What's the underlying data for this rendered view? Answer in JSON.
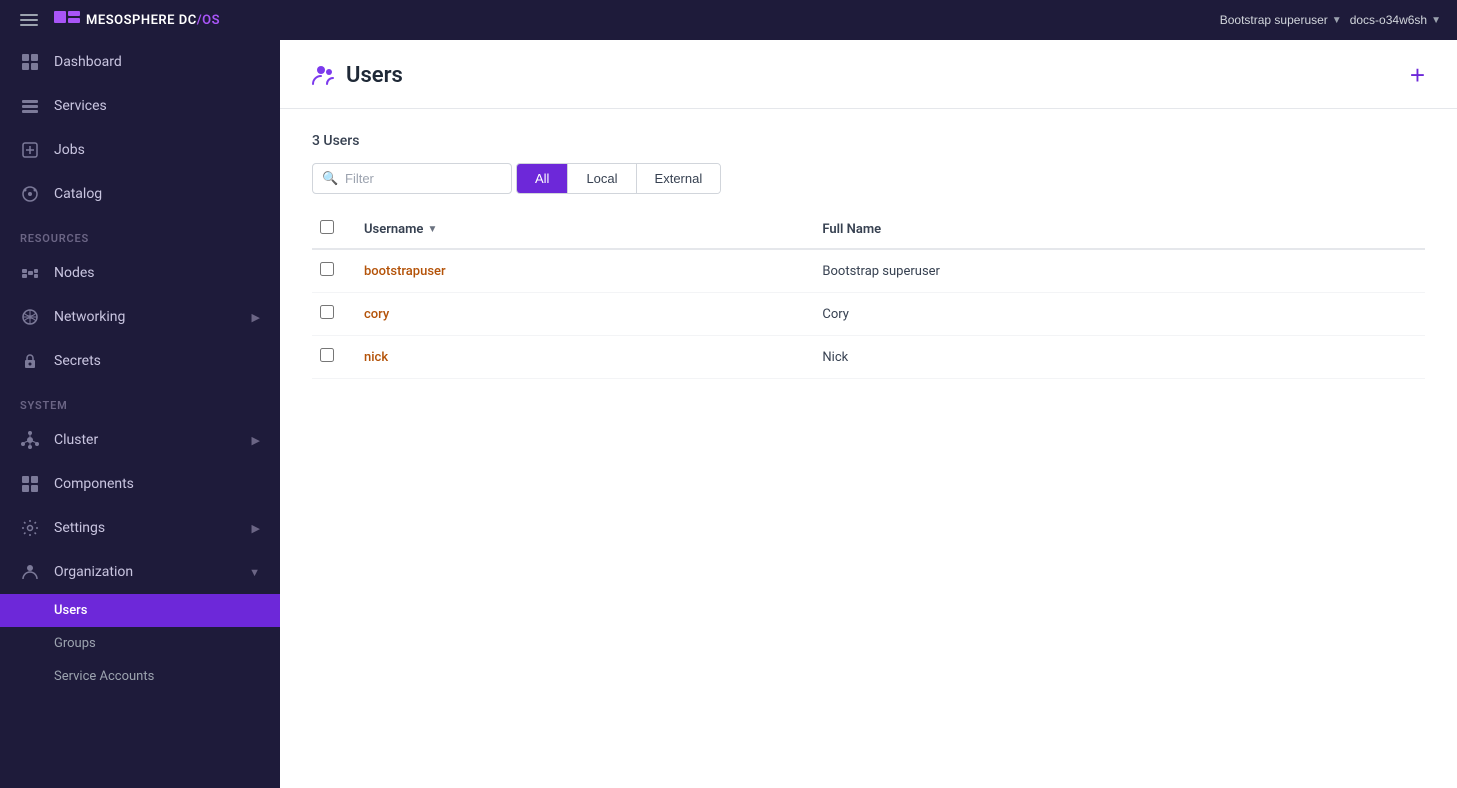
{
  "topbar": {
    "hamburger_label": "Menu",
    "logo_brand": "MESOSPHERE",
    "logo_dc": "DC",
    "logo_os": "OS",
    "user_label": "Bootstrap superuser",
    "cluster_label": "docs-o34w6sh"
  },
  "sidebar": {
    "nav_items": [
      {
        "id": "dashboard",
        "label": "Dashboard",
        "icon": "dashboard"
      },
      {
        "id": "services",
        "label": "Services",
        "icon": "services"
      },
      {
        "id": "jobs",
        "label": "Jobs",
        "icon": "jobs"
      },
      {
        "id": "catalog",
        "label": "Catalog",
        "icon": "catalog"
      }
    ],
    "resources_label": "Resources",
    "resource_items": [
      {
        "id": "nodes",
        "label": "Nodes",
        "icon": "nodes",
        "hasArrow": false
      },
      {
        "id": "networking",
        "label": "Networking",
        "icon": "networking",
        "hasArrow": true
      },
      {
        "id": "secrets",
        "label": "Secrets",
        "icon": "secrets",
        "hasArrow": false
      }
    ],
    "system_label": "System",
    "system_items": [
      {
        "id": "cluster",
        "label": "Cluster",
        "icon": "cluster",
        "hasArrow": true
      },
      {
        "id": "components",
        "label": "Components",
        "icon": "components",
        "hasArrow": false
      },
      {
        "id": "settings",
        "label": "Settings",
        "icon": "settings",
        "hasArrow": true
      },
      {
        "id": "organization",
        "label": "Organization",
        "icon": "organization",
        "hasArrow": true,
        "expanded": true
      }
    ],
    "org_subnav": [
      {
        "id": "users",
        "label": "Users",
        "active": true
      },
      {
        "id": "groups",
        "label": "Groups"
      },
      {
        "id": "service-accounts",
        "label": "Service Accounts"
      }
    ]
  },
  "page": {
    "title": "Users",
    "users_count": "3 Users",
    "filter_placeholder": "Filter",
    "add_button_label": "+",
    "tabs": [
      {
        "id": "all",
        "label": "All",
        "active": true
      },
      {
        "id": "local",
        "label": "Local",
        "active": false
      },
      {
        "id": "external",
        "label": "External",
        "active": false
      }
    ],
    "table": {
      "columns": [
        {
          "id": "username",
          "label": "Username",
          "sortable": true
        },
        {
          "id": "fullname",
          "label": "Full Name",
          "sortable": false
        }
      ],
      "rows": [
        {
          "username": "bootstrapuser",
          "fullname": "Bootstrap superuser"
        },
        {
          "username": "cory",
          "fullname": "Cory"
        },
        {
          "username": "nick",
          "fullname": "Nick"
        }
      ]
    }
  }
}
